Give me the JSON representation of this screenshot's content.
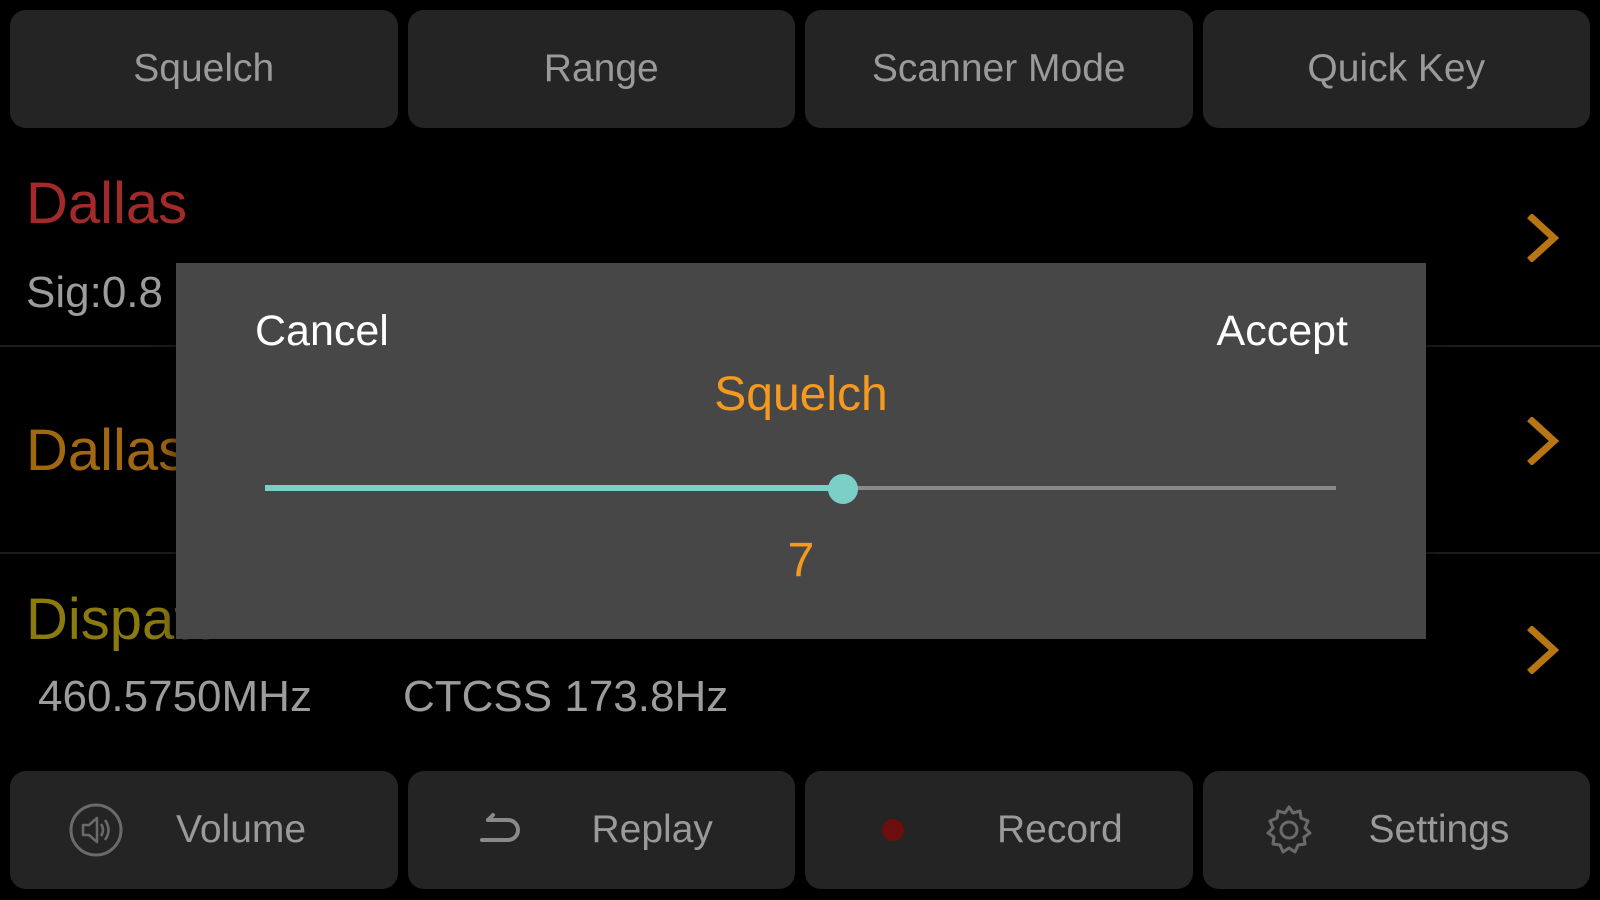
{
  "top_bar": {
    "items": [
      {
        "label": "Squelch"
      },
      {
        "label": "Range"
      },
      {
        "label": "Scanner Mode"
      },
      {
        "label": "Quick Key"
      }
    ]
  },
  "rows": [
    {
      "title": "Dallas",
      "subtitle": "Sig:0.8",
      "title_color": "#a22a2a"
    },
    {
      "title": "Dallas",
      "title_color": "#a06810"
    },
    {
      "title": "Dispatch",
      "frequency": "460.5750MHz",
      "tone": "CTCSS 173.8Hz",
      "title_color": "#8a7a10"
    }
  ],
  "dialog": {
    "cancel_label": "Cancel",
    "accept_label": "Accept",
    "title": "Squelch",
    "slider": {
      "value": "7",
      "fraction": 0.54
    }
  },
  "bottom_bar": {
    "items": [
      {
        "label": "Volume",
        "icon": "speaker-icon"
      },
      {
        "label": "Replay",
        "icon": "replay-icon"
      },
      {
        "label": "Record",
        "icon": "record-dot-icon"
      },
      {
        "label": "Settings",
        "icon": "gear-icon"
      }
    ]
  },
  "colors": {
    "accent_orange": "#f59a1e",
    "slider_teal": "#7ccfc7",
    "record_red": "#7a0f0f"
  }
}
